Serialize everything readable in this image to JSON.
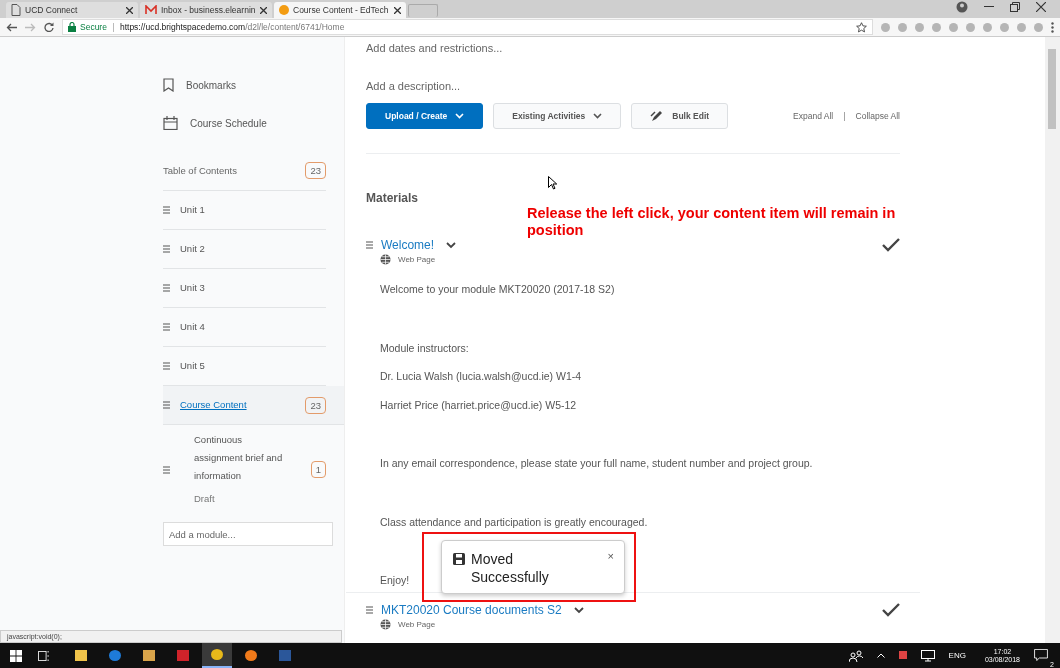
{
  "browser": {
    "tabs": [
      {
        "title": "UCD Connect",
        "kind": "page",
        "selected": false
      },
      {
        "title": "Inbox - business.elearnin",
        "kind": "mail",
        "selected": false
      },
      {
        "title": "Course Content - EdTech",
        "kind": "site",
        "selected": true
      }
    ],
    "secure_label": "Secure",
    "url_host": "https://ucd.brightspacedemo.com",
    "url_path": "/d2l/le/content/6741/Home"
  },
  "sidebar": {
    "nav_items": [
      {
        "label": "Bookmarks",
        "kind": "bookmark"
      },
      {
        "label": "Course Schedule",
        "kind": "calendar"
      }
    ],
    "toc": {
      "label": "Table of Contents",
      "count": "23"
    },
    "modules": [
      {
        "label": "Unit 1",
        "selected": false
      },
      {
        "label": "Unit 2",
        "selected": false
      },
      {
        "label": "Unit 3",
        "selected": false
      },
      {
        "label": "Unit 4",
        "selected": false
      },
      {
        "label": "Unit 5",
        "selected": false
      },
      {
        "label": "Course Content",
        "count": "23",
        "selected": true
      },
      {
        "label": "Continuous assignment brief and information",
        "status": "Draft",
        "count": "1",
        "selected": false
      }
    ],
    "add_module_placeholder": "Add a module..."
  },
  "main": {
    "add_dates": "Add dates and restrictions...",
    "add_description": "Add a description...",
    "buttons": [
      {
        "label": "Upload / Create",
        "kind": "primary"
      },
      {
        "label": "Existing Activities",
        "kind": "dropdown"
      },
      {
        "label": "Bulk Edit",
        "kind": "edit"
      }
    ],
    "expand_all": "Expand All",
    "separator": "|",
    "collapse_all": "Collapse All",
    "section_title": "Materials",
    "items": [
      {
        "title": "Welcome!",
        "type": "Web Page",
        "body": [
          [
            "Welcome to your module MKT20020 (2017-18 S2)"
          ],
          [
            "Module instructors:",
            "Dr. Lucia Walsh (lucia.walsh@ucd.ie) W1-4",
            "Harriet Price (harriet.price@ucd.ie) W5-12"
          ],
          [
            "In any email correspondence, please state your full name, student number and project group."
          ],
          [
            "Class attendance and participation is greatly encouraged."
          ],
          [
            "Enjoy!"
          ]
        ]
      },
      {
        "title": "MKT20020 Course documents S2",
        "type": "Web Page"
      }
    ]
  },
  "annotation": "Release the left click, your content item will remain in position",
  "toast": {
    "message": "Moved Successfully",
    "close": "×"
  },
  "status_url": "javascript:void(0);",
  "taskbar": {
    "apps": [
      {
        "kind": "explorer",
        "active": false
      },
      {
        "kind": "edge",
        "active": false
      },
      {
        "kind": "media",
        "active": false
      },
      {
        "kind": "adobe",
        "active": false
      },
      {
        "kind": "chrome",
        "active": true
      },
      {
        "kind": "firefox",
        "active": false
      },
      {
        "kind": "word",
        "active": false
      }
    ],
    "language": "ENG",
    "time": "17:02",
    "date": "03/08/2018",
    "notifications": "2"
  }
}
